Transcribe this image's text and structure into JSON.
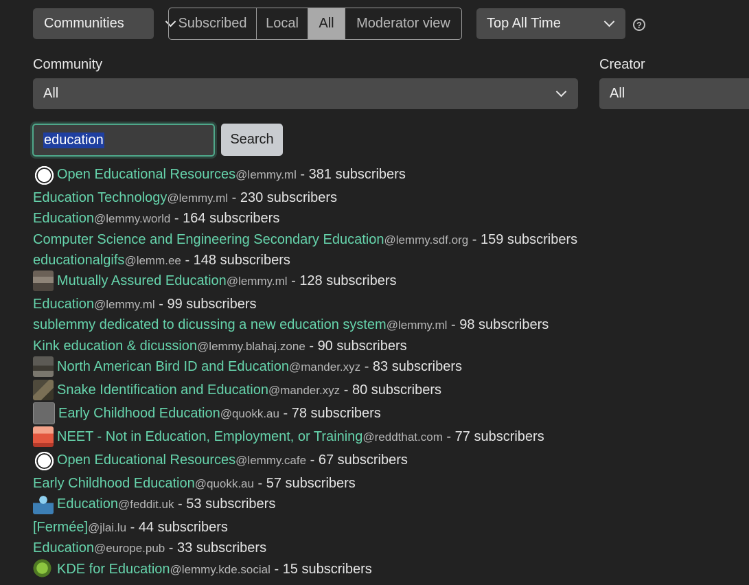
{
  "toolbar": {
    "listing_type": "Communities",
    "filters": [
      "Subscribed",
      "Local",
      "All",
      "Moderator view"
    ],
    "active_filter": "All",
    "sort": "Top All Time",
    "help_glyph": "?"
  },
  "filters": {
    "community_label": "Community",
    "community_value": "All",
    "creator_label": "Creator",
    "creator_value": "All"
  },
  "search": {
    "query": "education",
    "button_label": "Search"
  },
  "results": [
    {
      "name": "Open Educational Resources",
      "instance": "@lemmy.ml",
      "subs": "381 subscribers",
      "icon": "globe-icon"
    },
    {
      "name": "Education Technology",
      "instance": "@lemmy.ml",
      "subs": "230 subscribers",
      "icon": ""
    },
    {
      "name": "Education",
      "instance": "@lemmy.world",
      "subs": "164 subscribers",
      "icon": ""
    },
    {
      "name": "Computer Science and Engineering Secondary Education",
      "instance": "@lemmy.sdf.org",
      "subs": "159 subscribers",
      "icon": ""
    },
    {
      "name": "educationalgifs",
      "instance": "@lemm.ee",
      "subs": "148 subscribers",
      "icon": ""
    },
    {
      "name": "Mutually Assured Education",
      "instance": "@lemmy.ml",
      "subs": "128 subscribers",
      "icon": "building-icon"
    },
    {
      "name": "Education",
      "instance": "@lemmy.ml",
      "subs": "99 subscribers",
      "icon": ""
    },
    {
      "name": "sublemmy dedicated to dicussing a new education system",
      "instance": "@lemmy.ml",
      "subs": "98 subscribers",
      "icon": ""
    },
    {
      "name": "Kink education & dicussion",
      "instance": "@lemmy.blahaj.zone",
      "subs": "90 subscribers",
      "icon": ""
    },
    {
      "name": "North American Bird ID and Education",
      "instance": "@mander.xyz",
      "subs": "83 subscribers",
      "icon": "bird-photo-icon"
    },
    {
      "name": "Snake Identification and Education",
      "instance": "@mander.xyz",
      "subs": "80 subscribers",
      "icon": "snake-photo-icon"
    },
    {
      "name": "Early Childhood Education",
      "instance": "@quokk.au",
      "subs": "78 subscribers",
      "icon": "image-placeholder-icon"
    },
    {
      "name": "NEET - Not in Education, Employment, or Training",
      "instance": "@reddthat.com",
      "subs": "77 subscribers",
      "icon": "school-building-icon"
    },
    {
      "name": "Open Educational Resources",
      "instance": "@lemmy.cafe",
      "subs": "67 subscribers",
      "icon": "globe-icon"
    },
    {
      "name": "Early Childhood Education",
      "instance": "@quokk.au",
      "subs": "57 subscribers",
      "icon": ""
    },
    {
      "name": "Education",
      "instance": "@feddit.uk",
      "subs": "53 subscribers",
      "icon": "reading-person-icon"
    },
    {
      "name": "[Fermée]",
      "instance": "@jlai.lu",
      "subs": "44 subscribers",
      "icon": ""
    },
    {
      "name": "Education",
      "instance": "@europe.pub",
      "subs": "33 subscribers",
      "icon": ""
    },
    {
      "name": "KDE for Education",
      "instance": "@lemmy.kde.social",
      "subs": "15 subscribers",
      "icon": "kde-dragon-icon"
    }
  ],
  "separator": " - "
}
